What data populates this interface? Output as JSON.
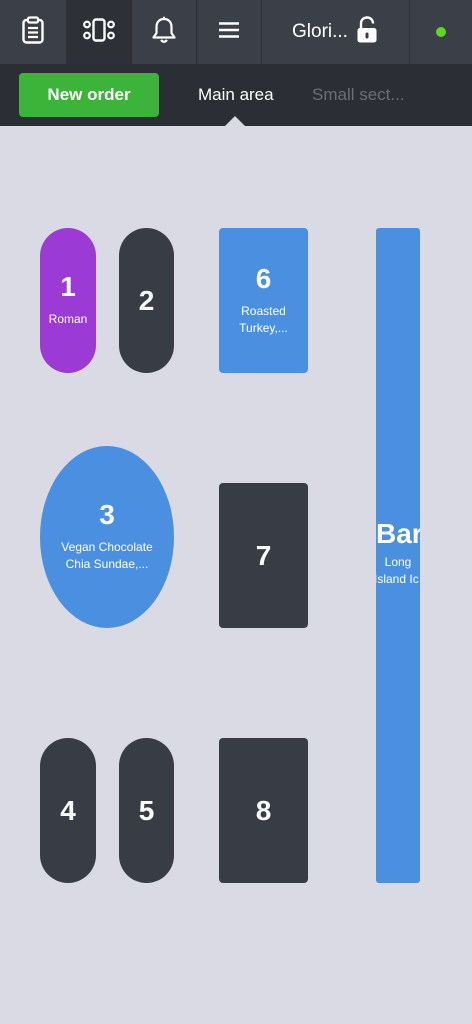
{
  "topbar": {
    "icons": [
      "clipboard-icon",
      "floor-plan-icon",
      "bell-icon",
      "menu-icon"
    ],
    "user_name": "Glori...",
    "status_color": "#5fd61f"
  },
  "subbar": {
    "new_order_label": "New order",
    "tabs": [
      {
        "label": "Main area",
        "active": true
      },
      {
        "label": "Small sect...",
        "active": false
      }
    ]
  },
  "tables": [
    {
      "id": "1",
      "note": "Roman",
      "color": "#9b3ad4"
    },
    {
      "id": "2",
      "note": "",
      "color": "#383c44"
    },
    {
      "id": "6",
      "note": "Roasted Turkey,...",
      "color": "#4a8fe0"
    },
    {
      "id": "3",
      "note": "Vegan Chocolate Chia Sundae,...",
      "color": "#4a8fe0"
    },
    {
      "id": "7",
      "note": "",
      "color": "#383c44"
    },
    {
      "id": "4",
      "note": "",
      "color": "#383c44"
    },
    {
      "id": "5",
      "note": "",
      "color": "#383c44"
    },
    {
      "id": "8",
      "note": "",
      "color": "#383c44"
    }
  ],
  "bar": {
    "name": "Bar",
    "note_line1": "Long",
    "note_line2": "Island Ic",
    "color": "#4a8fe0"
  }
}
